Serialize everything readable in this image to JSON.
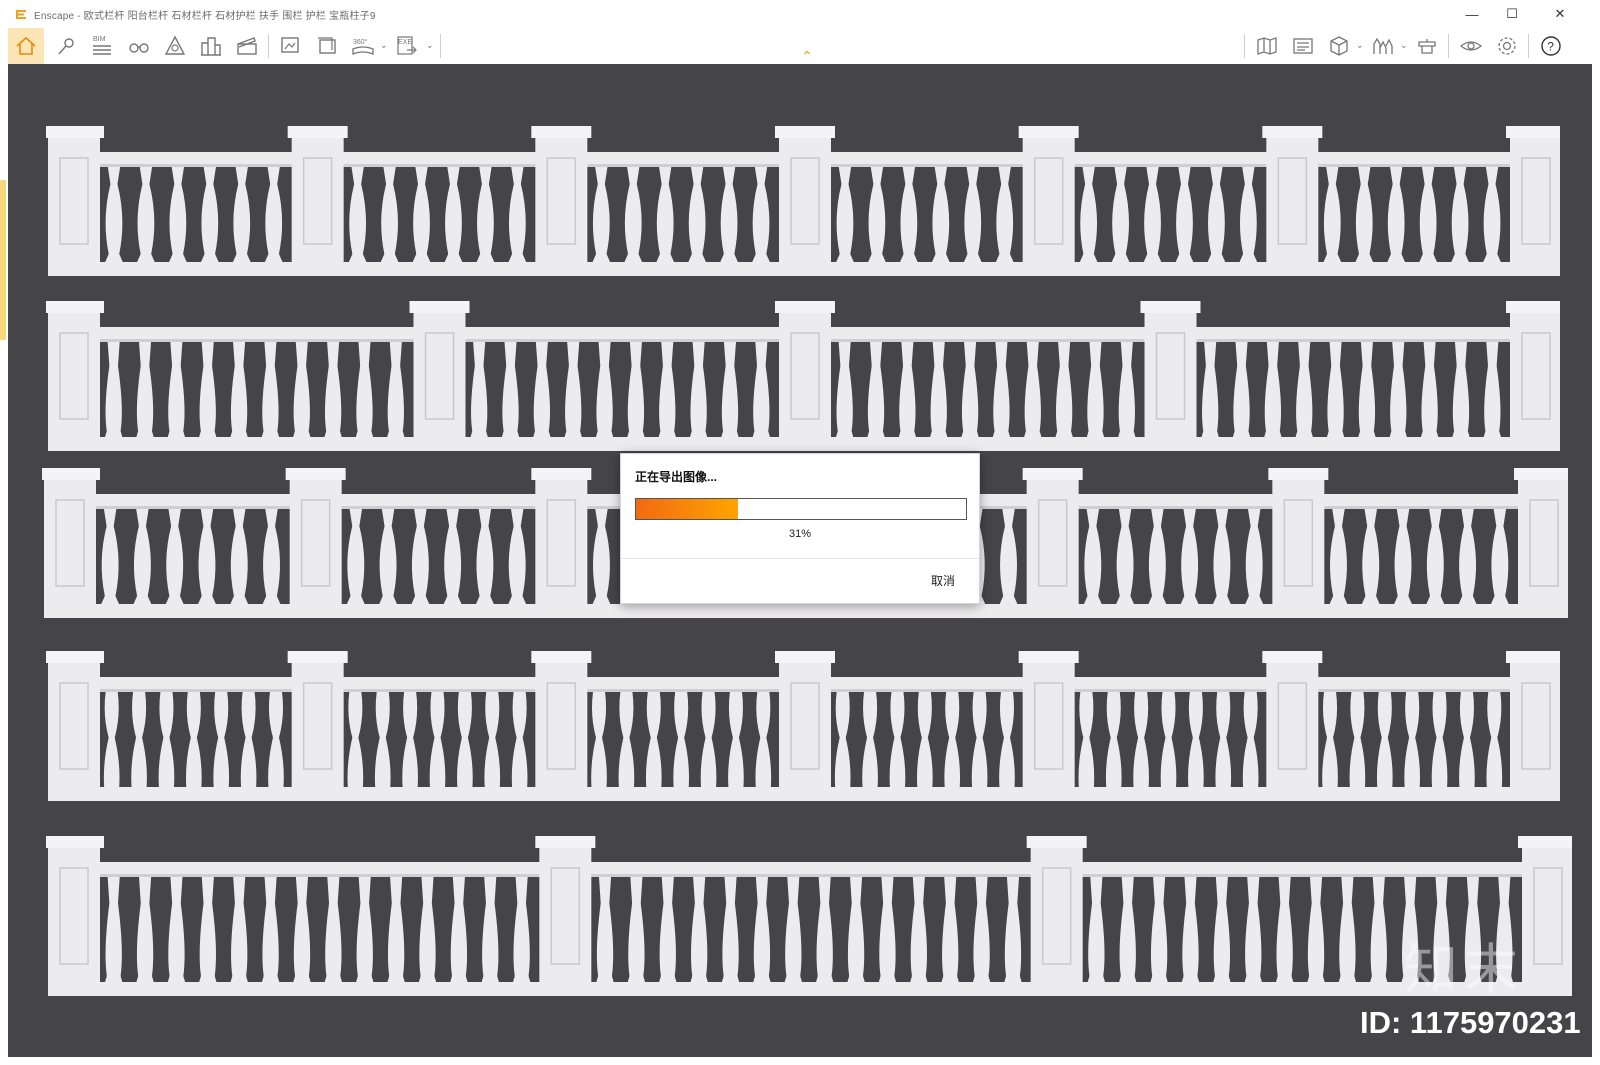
{
  "window": {
    "title": "Enscape - 欧式栏杆 阳台栏杆 石材栏杆 石材护栏 扶手 围栏 护栏 宝瓶柱子9"
  },
  "toolbar": {
    "bim_label": "BIM",
    "pano_label": "360°",
    "exe_label": "EXE",
    "help_label": "?",
    "icons": [
      "home-icon",
      "map-pin-icon",
      "bim-list-icon",
      "binoculars-icon",
      "triangle-icon",
      "buildings-icon",
      "clapper-icon",
      "screenshot-icon",
      "batch-render-icon",
      "panorama-icon",
      "exe-export-icon",
      "map-icon",
      "render-settings-icon",
      "cube-icon",
      "skyline-icon",
      "asset-library-icon",
      "eye-icon",
      "gear-icon",
      "help-icon"
    ]
  },
  "dialog": {
    "title": "正在导出图像...",
    "progress": 0.31,
    "progress_text": "31%",
    "cancel_label": "取消"
  },
  "watermark": {
    "logo": "知末",
    "id_text": "ID: 1175970231"
  },
  "colors": {
    "viewport_bg": "#454449",
    "stone": "#ecebee",
    "accent": "#f2a01f",
    "progress_start": "#f26a13",
    "progress_end": "#ffa400"
  }
}
